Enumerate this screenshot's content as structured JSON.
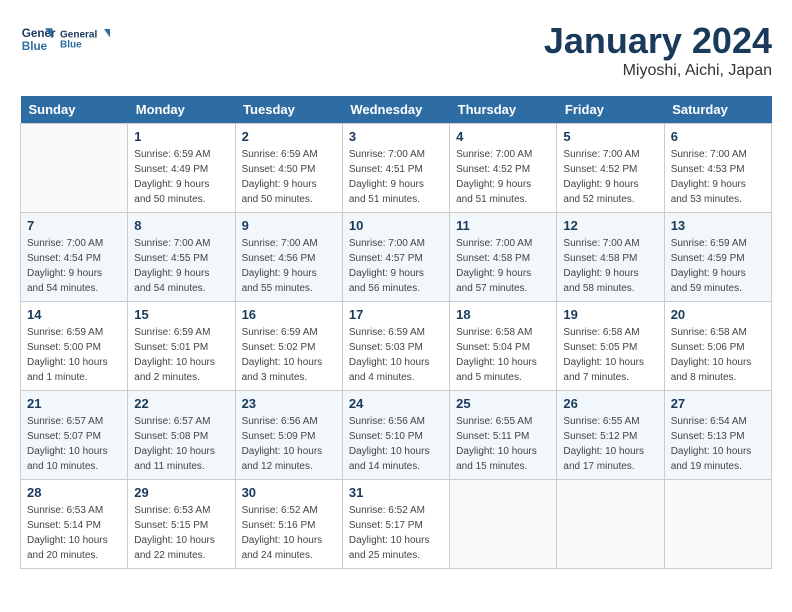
{
  "header": {
    "logo_line1": "General",
    "logo_line2": "Blue",
    "month": "January 2024",
    "location": "Miyoshi, Aichi, Japan"
  },
  "weekdays": [
    "Sunday",
    "Monday",
    "Tuesday",
    "Wednesday",
    "Thursday",
    "Friday",
    "Saturday"
  ],
  "weeks": [
    [
      {
        "day": "",
        "sunrise": "",
        "sunset": "",
        "daylight": ""
      },
      {
        "day": "1",
        "sunrise": "6:59 AM",
        "sunset": "4:49 PM",
        "daylight": "9 hours and 50 minutes."
      },
      {
        "day": "2",
        "sunrise": "6:59 AM",
        "sunset": "4:50 PM",
        "daylight": "9 hours and 50 minutes."
      },
      {
        "day": "3",
        "sunrise": "7:00 AM",
        "sunset": "4:51 PM",
        "daylight": "9 hours and 51 minutes."
      },
      {
        "day": "4",
        "sunrise": "7:00 AM",
        "sunset": "4:52 PM",
        "daylight": "9 hours and 51 minutes."
      },
      {
        "day": "5",
        "sunrise": "7:00 AM",
        "sunset": "4:52 PM",
        "daylight": "9 hours and 52 minutes."
      },
      {
        "day": "6",
        "sunrise": "7:00 AM",
        "sunset": "4:53 PM",
        "daylight": "9 hours and 53 minutes."
      }
    ],
    [
      {
        "day": "7",
        "sunrise": "7:00 AM",
        "sunset": "4:54 PM",
        "daylight": "9 hours and 54 minutes."
      },
      {
        "day": "8",
        "sunrise": "7:00 AM",
        "sunset": "4:55 PM",
        "daylight": "9 hours and 54 minutes."
      },
      {
        "day": "9",
        "sunrise": "7:00 AM",
        "sunset": "4:56 PM",
        "daylight": "9 hours and 55 minutes."
      },
      {
        "day": "10",
        "sunrise": "7:00 AM",
        "sunset": "4:57 PM",
        "daylight": "9 hours and 56 minutes."
      },
      {
        "day": "11",
        "sunrise": "7:00 AM",
        "sunset": "4:58 PM",
        "daylight": "9 hours and 57 minutes."
      },
      {
        "day": "12",
        "sunrise": "7:00 AM",
        "sunset": "4:58 PM",
        "daylight": "9 hours and 58 minutes."
      },
      {
        "day": "13",
        "sunrise": "6:59 AM",
        "sunset": "4:59 PM",
        "daylight": "9 hours and 59 minutes."
      }
    ],
    [
      {
        "day": "14",
        "sunrise": "6:59 AM",
        "sunset": "5:00 PM",
        "daylight": "10 hours and 1 minute."
      },
      {
        "day": "15",
        "sunrise": "6:59 AM",
        "sunset": "5:01 PM",
        "daylight": "10 hours and 2 minutes."
      },
      {
        "day": "16",
        "sunrise": "6:59 AM",
        "sunset": "5:02 PM",
        "daylight": "10 hours and 3 minutes."
      },
      {
        "day": "17",
        "sunrise": "6:59 AM",
        "sunset": "5:03 PM",
        "daylight": "10 hours and 4 minutes."
      },
      {
        "day": "18",
        "sunrise": "6:58 AM",
        "sunset": "5:04 PM",
        "daylight": "10 hours and 5 minutes."
      },
      {
        "day": "19",
        "sunrise": "6:58 AM",
        "sunset": "5:05 PM",
        "daylight": "10 hours and 7 minutes."
      },
      {
        "day": "20",
        "sunrise": "6:58 AM",
        "sunset": "5:06 PM",
        "daylight": "10 hours and 8 minutes."
      }
    ],
    [
      {
        "day": "21",
        "sunrise": "6:57 AM",
        "sunset": "5:07 PM",
        "daylight": "10 hours and 10 minutes."
      },
      {
        "day": "22",
        "sunrise": "6:57 AM",
        "sunset": "5:08 PM",
        "daylight": "10 hours and 11 minutes."
      },
      {
        "day": "23",
        "sunrise": "6:56 AM",
        "sunset": "5:09 PM",
        "daylight": "10 hours and 12 minutes."
      },
      {
        "day": "24",
        "sunrise": "6:56 AM",
        "sunset": "5:10 PM",
        "daylight": "10 hours and 14 minutes."
      },
      {
        "day": "25",
        "sunrise": "6:55 AM",
        "sunset": "5:11 PM",
        "daylight": "10 hours and 15 minutes."
      },
      {
        "day": "26",
        "sunrise": "6:55 AM",
        "sunset": "5:12 PM",
        "daylight": "10 hours and 17 minutes."
      },
      {
        "day": "27",
        "sunrise": "6:54 AM",
        "sunset": "5:13 PM",
        "daylight": "10 hours and 19 minutes."
      }
    ],
    [
      {
        "day": "28",
        "sunrise": "6:53 AM",
        "sunset": "5:14 PM",
        "daylight": "10 hours and 20 minutes."
      },
      {
        "day": "29",
        "sunrise": "6:53 AM",
        "sunset": "5:15 PM",
        "daylight": "10 hours and 22 minutes."
      },
      {
        "day": "30",
        "sunrise": "6:52 AM",
        "sunset": "5:16 PM",
        "daylight": "10 hours and 24 minutes."
      },
      {
        "day": "31",
        "sunrise": "6:52 AM",
        "sunset": "5:17 PM",
        "daylight": "10 hours and 25 minutes."
      },
      {
        "day": "",
        "sunrise": "",
        "sunset": "",
        "daylight": ""
      },
      {
        "day": "",
        "sunrise": "",
        "sunset": "",
        "daylight": ""
      },
      {
        "day": "",
        "sunrise": "",
        "sunset": "",
        "daylight": ""
      }
    ]
  ]
}
